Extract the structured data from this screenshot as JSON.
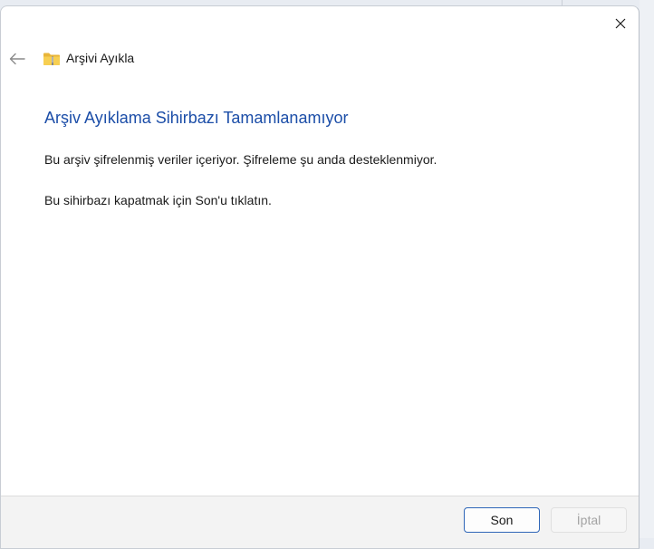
{
  "window": {
    "title": "Arşivi Ayıkla",
    "close_icon": "close-icon",
    "back_icon": "back-arrow-icon",
    "app_icon": "zip-folder-icon"
  },
  "main": {
    "heading": "Arşiv Ayıklama Sihirbazı Tamamlanamıyor",
    "message_encrypted": "Bu arşiv şifrelenmiş veriler içeriyor. Şifreleme şu anda desteklenmiyor.",
    "message_close": "Bu sihirbazı kapatmak için Son'u tıklatın."
  },
  "footer": {
    "finish_label": "Son",
    "cancel_label": "İptal"
  },
  "colors": {
    "heading": "#1c4ea8",
    "primary_border": "#2f66b8",
    "disabled_text": "#a3a3a3"
  }
}
